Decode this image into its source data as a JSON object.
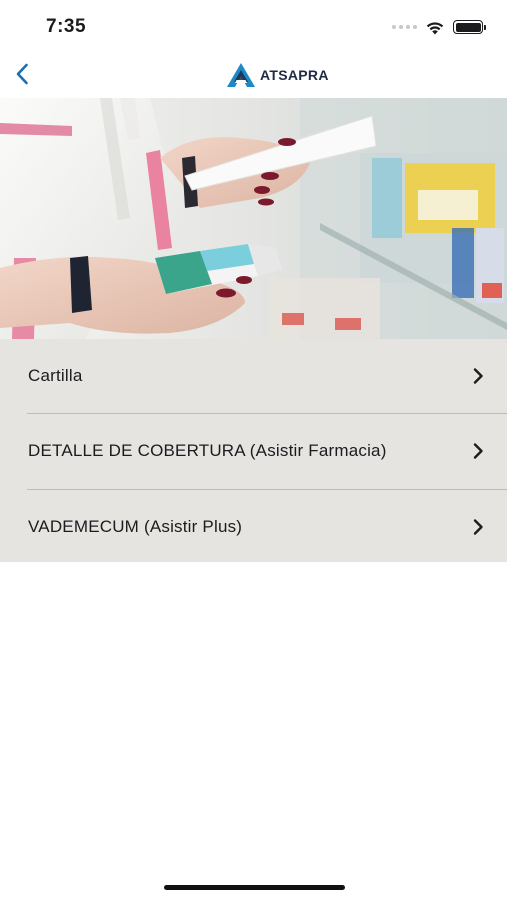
{
  "status_bar": {
    "time": "7:35",
    "icons": [
      "signal-dots-icon",
      "wifi-icon",
      "battery-icon"
    ]
  },
  "nav": {
    "back_icon": "chevron-left-icon",
    "brand_name": "ATSAPRA",
    "colors": {
      "back": "#1a6fb3",
      "logo_blue": "#1e88c8",
      "logo_dark": "#1f2a44"
    }
  },
  "hero": {
    "description_icon": "pharmacy-hero-image"
  },
  "menu": {
    "items": [
      {
        "label": "Cartilla"
      },
      {
        "label": "DETALLE DE COBERTURA (Asistir Farmacia)"
      },
      {
        "label": "VADEMECUM (Asistir Plus)"
      }
    ],
    "background": "#e6e4e1"
  }
}
